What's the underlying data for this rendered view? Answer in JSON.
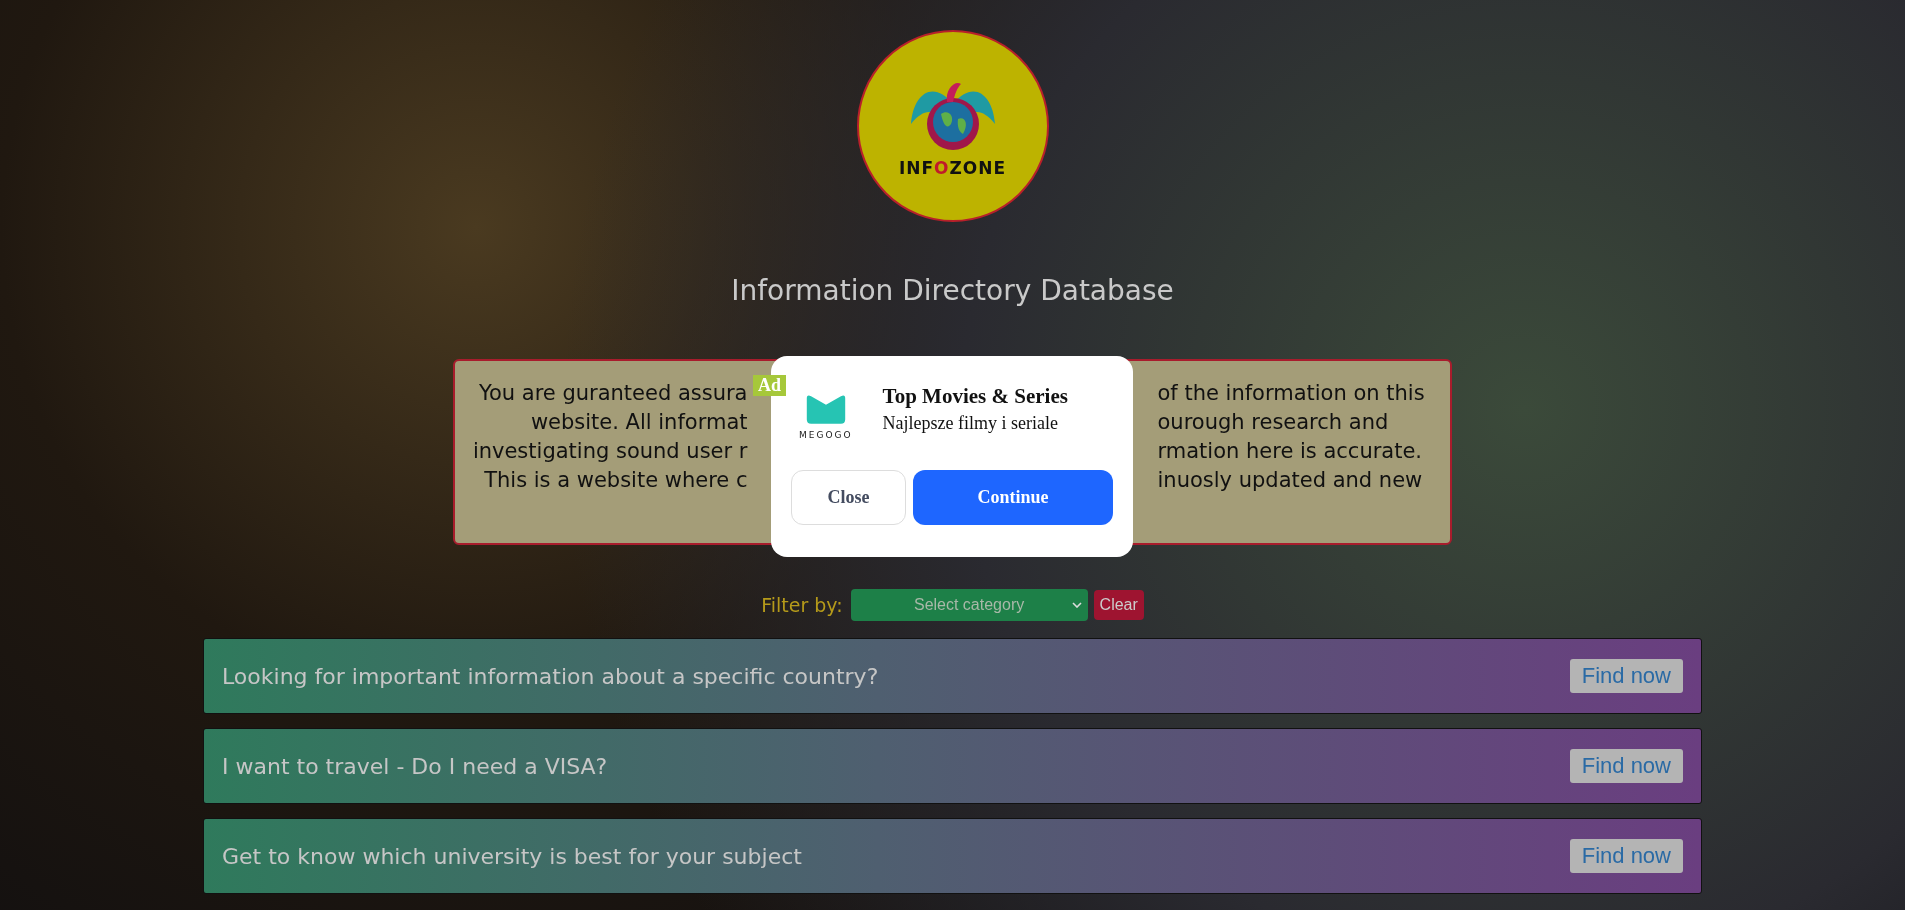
{
  "logo": {
    "text_before": "INF",
    "text_highlight": "O",
    "text_after": "ZONE"
  },
  "title": "Information Directory Database",
  "notice_lines": [
    {
      "left": "You are guranteed assura",
      "right": "of the information on this"
    },
    {
      "left": "website. All informat",
      "right": "ourough research and"
    },
    {
      "left": "investigating sound user r",
      "right": "rmation here is accurate."
    },
    {
      "left": "This is a website where c",
      "right": "inuosly updated and new"
    }
  ],
  "ad": {
    "badge": "Ad",
    "brand": "MEGOGO",
    "title": "Top Movies & Series",
    "subtitle": "Najlepsze filmy i seriale",
    "buttons": [
      "Close",
      "Continue"
    ]
  },
  "filter": {
    "label": "Filter by:",
    "placeholder": "Select category",
    "clear": "Clear"
  },
  "rows": [
    {
      "text": "Looking for important information about a specific country?",
      "button": "Find now"
    },
    {
      "text": "I want to travel - Do I need a VISA?",
      "button": "Find now"
    },
    {
      "text": "Get to know which university is best for your subject",
      "button": "Find now"
    }
  ]
}
